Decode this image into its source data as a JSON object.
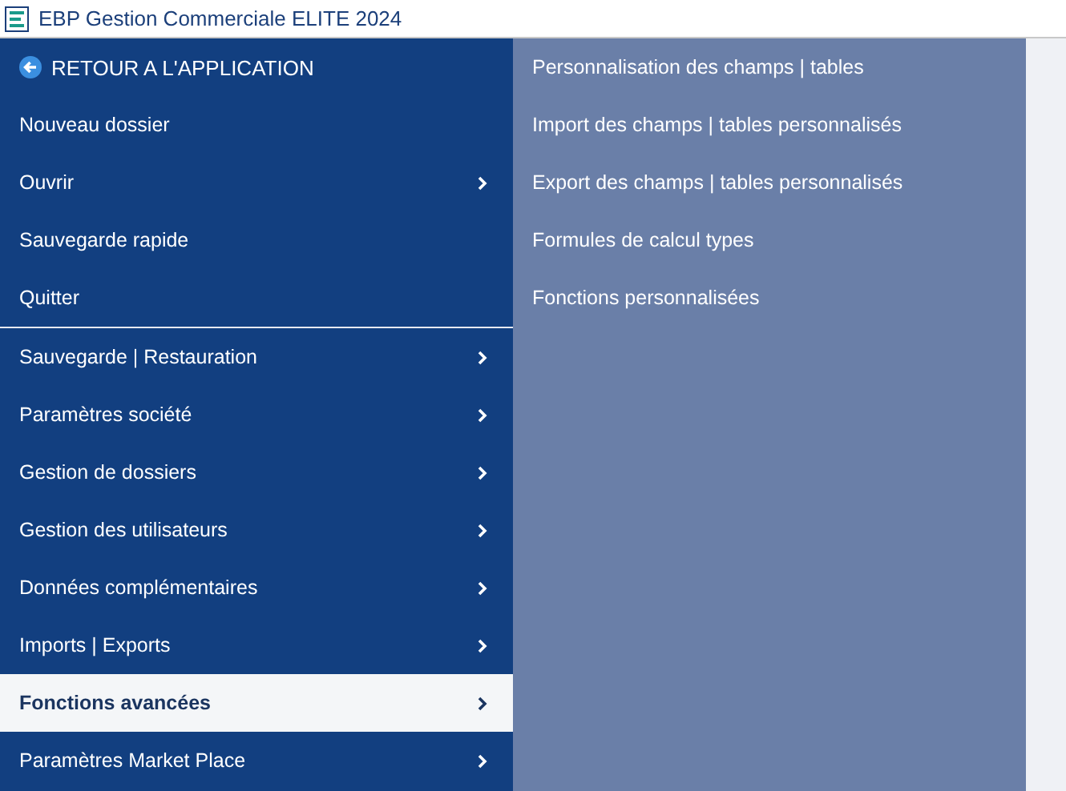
{
  "window": {
    "title": "EBP Gestion Commerciale ELITE 2024"
  },
  "menu": {
    "back": "RETOUR A L'APPLICATION",
    "groups": [
      {
        "items": [
          {
            "label": "Nouveau dossier",
            "has_submenu": false,
            "selected": false
          },
          {
            "label": "Ouvrir",
            "has_submenu": true,
            "selected": false
          },
          {
            "label": "Sauvegarde rapide",
            "has_submenu": false,
            "selected": false
          },
          {
            "label": "Quitter",
            "has_submenu": false,
            "selected": false
          }
        ]
      },
      {
        "items": [
          {
            "label": "Sauvegarde | Restauration",
            "has_submenu": true,
            "selected": false
          },
          {
            "label": "Paramètres société",
            "has_submenu": true,
            "selected": false
          },
          {
            "label": "Gestion de dossiers",
            "has_submenu": true,
            "selected": false
          },
          {
            "label": "Gestion des utilisateurs",
            "has_submenu": true,
            "selected": false
          },
          {
            "label": "Données complémentaires",
            "has_submenu": true,
            "selected": false
          },
          {
            "label": "Imports | Exports",
            "has_submenu": true,
            "selected": false
          },
          {
            "label": "Fonctions avancées",
            "has_submenu": true,
            "selected": true
          },
          {
            "label": "Paramètres Market Place",
            "has_submenu": true,
            "selected": false
          }
        ]
      }
    ]
  },
  "submenu": {
    "items": [
      {
        "label": "Personnalisation des champs | tables"
      },
      {
        "label": "Import des champs | tables personnalisés"
      },
      {
        "label": "Export des champs | tables personnalisés"
      },
      {
        "label": "Formules de calcul types"
      },
      {
        "label": "Fonctions personnalisées"
      }
    ]
  }
}
